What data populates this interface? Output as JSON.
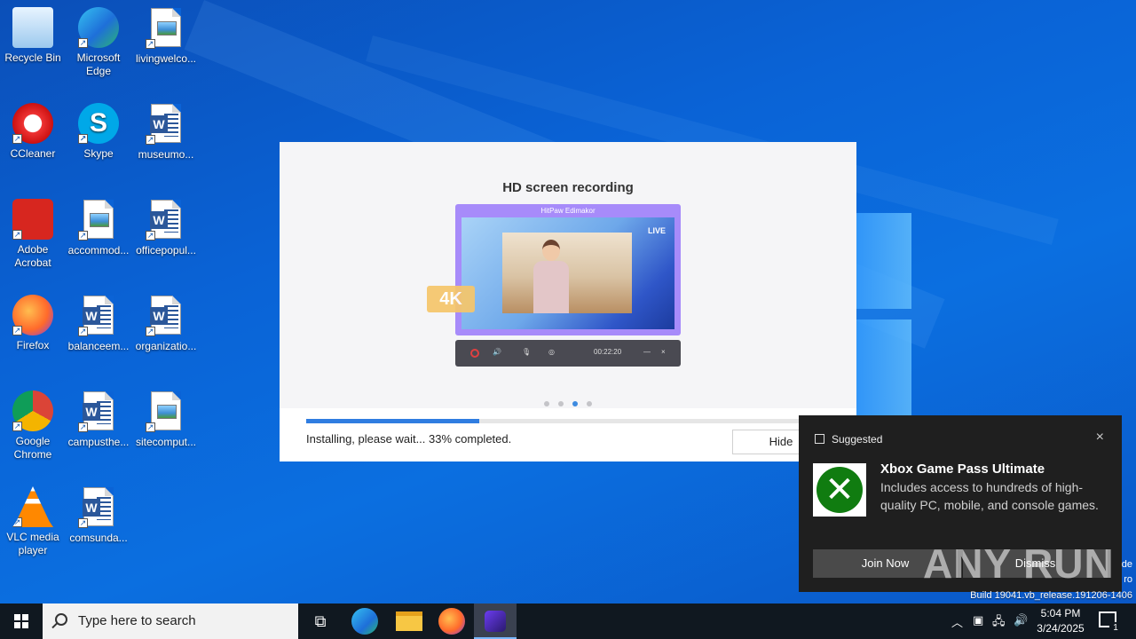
{
  "desktop": {
    "icons": [
      {
        "label": "Recycle Bin",
        "icon": "recycle-bin-icon"
      },
      {
        "label": "Microsoft Edge",
        "icon": "edge-icon"
      },
      {
        "label": "livingwelco...",
        "icon": "image-file-icon"
      },
      {
        "label": "CCleaner",
        "icon": "ccleaner-icon"
      },
      {
        "label": "Skype",
        "icon": "skype-icon"
      },
      {
        "label": "museumo...",
        "icon": "word-doc-icon"
      },
      {
        "label": "Adobe Acrobat",
        "icon": "acrobat-icon"
      },
      {
        "label": "accommod...",
        "icon": "image-file-icon"
      },
      {
        "label": "officepopul...",
        "icon": "word-doc-icon"
      },
      {
        "label": "Firefox",
        "icon": "firefox-icon"
      },
      {
        "label": "balanceem...",
        "icon": "word-doc-icon"
      },
      {
        "label": "organizatio...",
        "icon": "word-doc-icon"
      },
      {
        "label": "Google Chrome",
        "icon": "chrome-icon"
      },
      {
        "label": "campusthe...",
        "icon": "word-doc-icon"
      },
      {
        "label": "sitecomput...",
        "icon": "image-file-icon"
      },
      {
        "label": "VLC media player",
        "icon": "vlc-icon"
      },
      {
        "label": "comsunda...",
        "icon": "word-doc-icon"
      }
    ]
  },
  "installer": {
    "slide_title": "HD screen recording",
    "preview_app_name": "HitPaw Edimakor",
    "live_label": "LIVE",
    "badge_4k": "4K",
    "timer": "00:22:20",
    "minimize": "—",
    "close": "×",
    "progress": 0.33,
    "status_text": "Installing, please wait... 33% completed.",
    "hide_label": "Hide",
    "carousel_active_index": 2
  },
  "toast": {
    "header": "Suggested",
    "close": "×",
    "title": "Xbox Game Pass Ultimate",
    "body": "Includes access to hundreds of high-quality PC, mobile, and console games.",
    "join_label": "Join Now",
    "dismiss_label": "Dismiss"
  },
  "watermark": "ANY RUN",
  "build_text": "Build 19041.vb_release.191206-1406",
  "edge_text_1": "de",
  "edge_text_2": "ro",
  "taskbar": {
    "search_placeholder": "Type here to search",
    "time": "5:04 PM",
    "date": "3/24/2025",
    "notification_count": "1"
  },
  "colors": {
    "desktop": "#0a63d6",
    "taskbar": "#101820",
    "progress": "#2f7de1",
    "xbox": "#107c10"
  }
}
